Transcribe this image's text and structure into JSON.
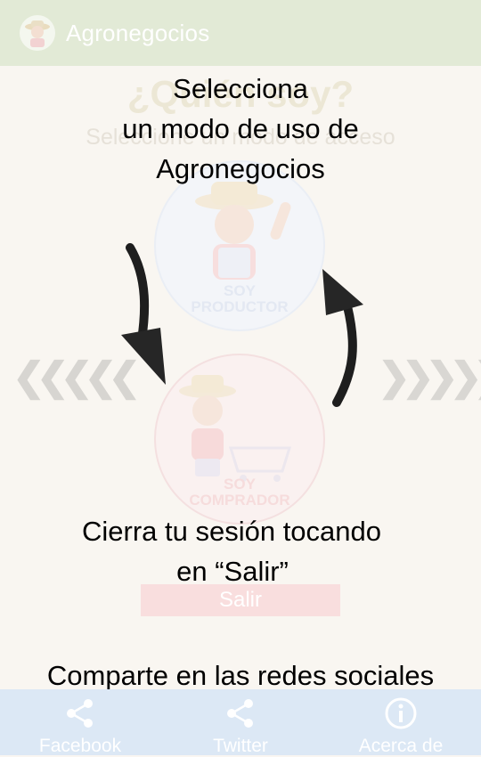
{
  "app_bar": {
    "title": "Agronegocios",
    "logo_icon": "farmer-logo-icon"
  },
  "background": {
    "title": "¿Quién soy?",
    "subtitle": "Seleccione un modo de acceso",
    "roles": [
      {
        "label_line1": "SOY",
        "label_line2": "PRODUCTOR"
      },
      {
        "label_line1": "SOY",
        "label_line2": "COMPRADOR"
      }
    ],
    "logout_label": "Salir"
  },
  "overlay": {
    "hint_mode": [
      "Selecciona",
      "un modo de uso de",
      "Agronegocios"
    ],
    "hint_logout": [
      "Cierra tu sesión tocando",
      "en “Salir”"
    ],
    "hint_share": "Comparte en las redes sociales"
  },
  "bottom_nav": [
    {
      "label": "Facebook",
      "icon": "share-icon"
    },
    {
      "label": "Twitter",
      "icon": "share-icon"
    },
    {
      "label": "Acerca de",
      "icon": "info-icon"
    }
  ],
  "colors": {
    "app_bar": "#e2ead6",
    "bottom_bar": "#dce8f5",
    "background": "#f9f6f1",
    "logout_button": "#f9dede"
  }
}
